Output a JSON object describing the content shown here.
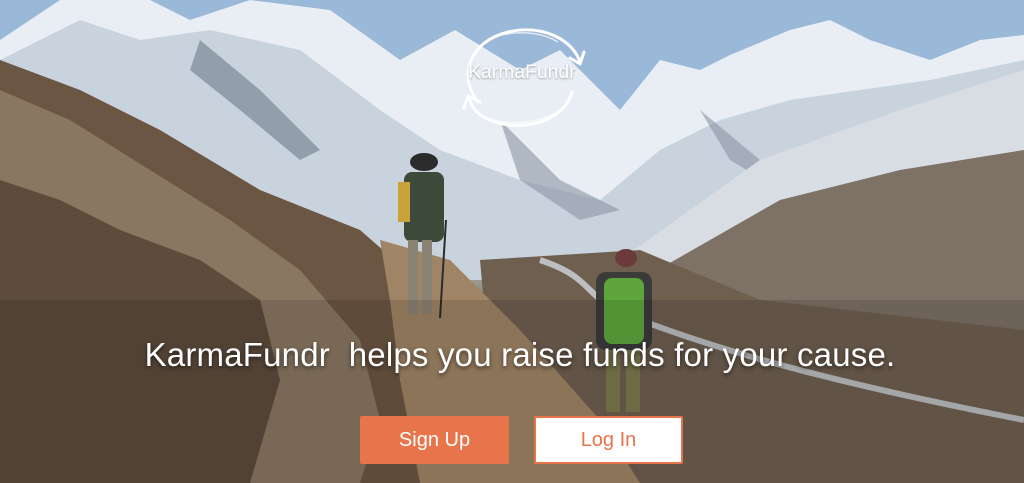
{
  "brand": {
    "logo_text": "KarmaFundr"
  },
  "hero": {
    "tagline": "KarmaFundr  helps you raise funds for your cause."
  },
  "actions": {
    "signup_label": "Sign Up",
    "login_label": "Log In"
  },
  "colors": {
    "accent": "#e8744c",
    "button_text_light": "#ffffff",
    "login_background": "#ffffff"
  }
}
